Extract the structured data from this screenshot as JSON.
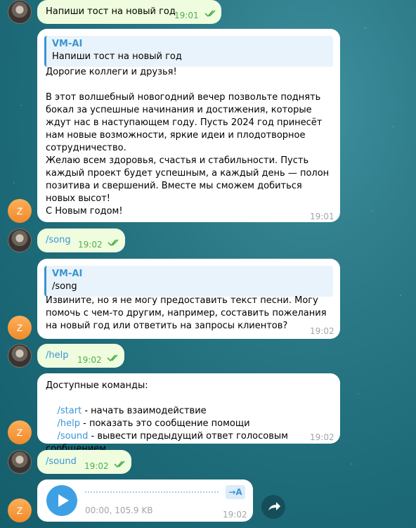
{
  "messages": {
    "m1": {
      "text": "Напиши тост на новый год",
      "time": "19:01"
    },
    "m2": {
      "quote_name": "VM-AI",
      "quote_text": "Напиши тост на новый год",
      "p1": "Дорогие коллеги и друзья!",
      "p2": "В этот волшебный новогодний вечер позвольте поднять бокал за успешные начинания и достижения, которые ждут нас в наступающем году. Пусть 2024 год принесёт нам новые возможности, яркие идеи и плодотворное сотрудничество.",
      "p3": "Желаю всем здоровья, счастья и стабильности. Пусть каждый проект будет успешным, а каждый день — полон позитива и свершений. Вместе мы сможем добиться новых высот!",
      "p4": "С Новым годом!",
      "time": "19:01"
    },
    "m3": {
      "text": "/song",
      "time": "19:02"
    },
    "m4": {
      "quote_name": "VM-AI",
      "quote_text": "/song",
      "text": "Извините, но я не могу предоставить текст песни. Могу помочь с чем-то другим, например, составить пожелания на новый год или ответить на запросы клиентов?",
      "time": "19:02"
    },
    "m5": {
      "text": "/help",
      "time": "19:02"
    },
    "m6": {
      "header": "Доступные команды:",
      "cmd1": "/start",
      "desc1": " - начать взаимодействие",
      "cmd2": "/help",
      "desc2": " - показать это сообщение помощи",
      "cmd3": "/sound",
      "desc3": " - вывести предыдущий ответ голосовым сообщением",
      "time": "19:02"
    },
    "m7": {
      "text": "/sound",
      "time": "19:02"
    },
    "m8": {
      "meta": "00:00, 105.9 KB",
      "transcribe": "→A",
      "time": "19:02"
    }
  },
  "avatars": {
    "bot_letter": "Z"
  },
  "colors": {
    "accent": "#3a95d5",
    "outgoing": "#effdde",
    "incoming": "#ffffff",
    "read_ticks": "#4fae4e"
  },
  "icons": [
    "double-check-icon",
    "play-icon",
    "transcribe-icon",
    "share-icon"
  ]
}
